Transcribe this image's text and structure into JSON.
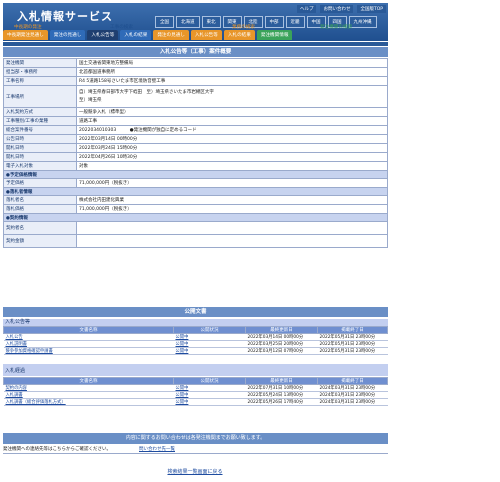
{
  "header": {
    "logo": "入札情報サービス",
    "toplinks": [
      "ヘルプ",
      "お問い合わせ",
      "全国版TOP"
    ],
    "regions": [
      "全国",
      "北海道",
      "東北",
      "関東",
      "北陸",
      "中部",
      "近畿",
      "中国",
      "四国",
      "九州沖縄"
    ],
    "label_left": "中長期の発注",
    "label_mid": "工事の検索",
    "label_mid2": "業務の検索",
    "label_right": "発注機関の検索",
    "nav": [
      {
        "label": "中長期発注見通し",
        "color": "#e8962a"
      },
      {
        "label": "発注の見通し",
        "color": "#2f6bb8"
      },
      {
        "label": "入札公告等",
        "color": "#1f3f70"
      },
      {
        "label": "入札の結果",
        "color": "#2f6bb8"
      },
      {
        "label": "発注の見通し",
        "color": "#e8962a"
      },
      {
        "label": "入札公告等",
        "color": "#e8962a"
      },
      {
        "label": "入札の結果",
        "color": "#e8962a"
      },
      {
        "label": "発注機関情報",
        "color": "#3aa35a"
      }
    ]
  },
  "title": "入札公告等（工事）案件概要",
  "info_rows": [
    {
      "k": "発注機関",
      "v": "国土交通省関東地方整備局",
      "h": 9
    },
    {
      "k": "担当部・事務所",
      "v": "北首都国道事務所",
      "h": 9
    },
    {
      "k": "工事名称",
      "v": "R4 5道路158号さいたま市区境防音壁工事",
      "h": 9
    },
    {
      "k": "工事場所",
      "v": "自）埼玉県春日部市大字下蛭田　至）埼玉県さいたま市岩槻区大字\n至）埼玉県",
      "h": 22
    },
    {
      "k": "入札契約方式",
      "v": "一般競争入札（標準型）",
      "h": 9
    },
    {
      "k": "工事種別/工事の業種",
      "v": "道路工事",
      "h": 9
    },
    {
      "k": "総合案件番号",
      "v": "2022034010303　　　●発注機関が独自に定めるコード",
      "h": 9
    },
    {
      "k": "公告日時",
      "v": "2022年03月14日 00時00分",
      "h": 9
    },
    {
      "k": "開札日時",
      "v": "2022年03月24日 15時00分",
      "h": 9
    },
    {
      "k": "開札日時",
      "v": "2022年04月26日 10時30分",
      "h": 9
    },
    {
      "k": "電子入札対象",
      "v": "対象",
      "h": 9
    }
  ],
  "section_yotei": "●予定価格情報",
  "yotei_price": {
    "k": "予定価格",
    "v": "71,000,000円（税抜き）"
  },
  "section_rakusatsu": "●落札者情報",
  "rakusatsu_name": {
    "k": "落札者名",
    "v": "株式会社内田建化興業"
  },
  "rakusatsu_price": {
    "k": "落札価格",
    "v": "71,000,000円（税抜き）"
  },
  "section_keiyaku": "●契約情報",
  "keiyaku_rows": [
    {
      "k": "契約者名",
      "v": ""
    },
    {
      "k": "契約金額",
      "v": ""
    }
  ],
  "docs_title": "公開文書",
  "group1_label": "入札公告等",
  "doc_headers": [
    "文書名称",
    "公開状況",
    "最終更新日",
    "掲載終了日"
  ],
  "group1_rows": [
    [
      "入札公告",
      "公開中",
      "2022年03月14日 00時00分",
      "2022年05月31日 23時00分"
    ],
    [
      "入札説明書",
      "公開中",
      "2022年03月25日 20時00分",
      "2022年05月31日 23時00分"
    ],
    [
      "競争参加資格確認申請書",
      "公開中",
      "2022年03月12日 07時00分",
      "2022年05月31日 23時00分"
    ]
  ],
  "group2_label": "入札経過",
  "group2_rows": [
    [
      "契約の内容",
      "公開中",
      "2022年07月31日 10時00分",
      "2024年03月31日 23時00分"
    ],
    [
      "入札調書",
      "公開中",
      "2022年05月24日 13時00分",
      "2024年03月31日 23時00分"
    ],
    [
      "入札調書（総合評価落札方式）",
      "公開中",
      "2022年05月26日 17時40分",
      "2024年03月31日 23時00分"
    ]
  ],
  "footer_banner": "内容に関するお問い合わせは各発注機関までお願い致します。",
  "footer_left": "発注機関への連絡先等はこちらからご確認ください。",
  "footer_link": "問い合わせ先一覧",
  "back_link": "検索結果一覧画面に戻る"
}
